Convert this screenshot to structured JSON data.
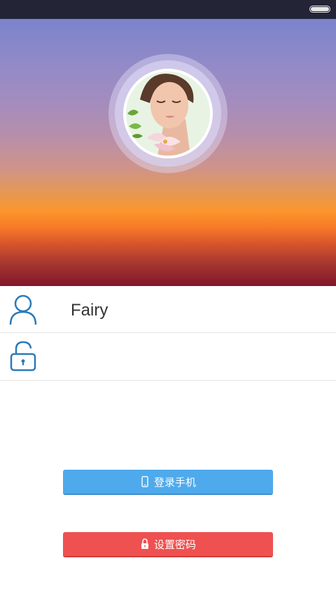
{
  "user_row": {
    "username": "Fairy",
    "icon": "user-icon"
  },
  "password_row": {
    "value": "",
    "icon": "lock-icon"
  },
  "buttons": {
    "login_phone": {
      "label": "登录手机",
      "icon": "phone-icon",
      "color": "#4eaaec"
    },
    "set_password": {
      "label": "设置密码",
      "icon": "lock-icon",
      "color": "#ef5151"
    }
  },
  "colors": {
    "status_bar": "#232537",
    "gradient_top": "#7b83cb",
    "gradient_orange": "#fb952d",
    "gradient_bottom": "#82152b",
    "icon_blue": "#2b7ab8"
  }
}
